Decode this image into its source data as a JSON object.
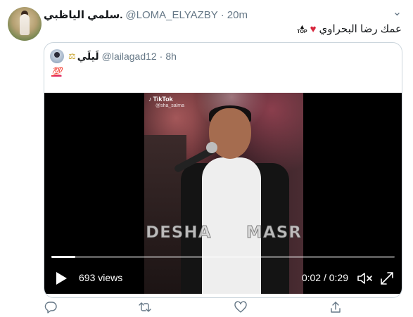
{
  "tweet": {
    "author_name": "سلمي الياظبي.",
    "author_handle": "@LOMA_ELYAZBY",
    "separator": "·",
    "time": "20m",
    "text": "عمك رضا البحراوي",
    "emoji_heart": "♥",
    "emoji_top": "TOP",
    "more_icon": "more-icon"
  },
  "quote": {
    "author_name": "لَيلَي",
    "author_emoji": "⚖",
    "author_handle": "@lailagad12",
    "separator": "·",
    "time": "8h",
    "text": "💯"
  },
  "video": {
    "tiktok_label": "TikTok",
    "tiktok_user": "@sha_salma",
    "watermark_left": "DESHA",
    "watermark_right": "MASR",
    "views": "693 views",
    "time": "0:02 / 0:29",
    "progress_fraction": 0.069,
    "icons": [
      "play-icon",
      "volume-muted-icon",
      "fullscreen-icon"
    ]
  },
  "actions": {
    "icons": [
      "reply-icon",
      "retweet-icon",
      "like-icon",
      "share-icon"
    ]
  },
  "colors": {
    "text": "#14171a",
    "muted": "#657786",
    "border": "#ccd6dd",
    "heart": "#d7263d"
  }
}
